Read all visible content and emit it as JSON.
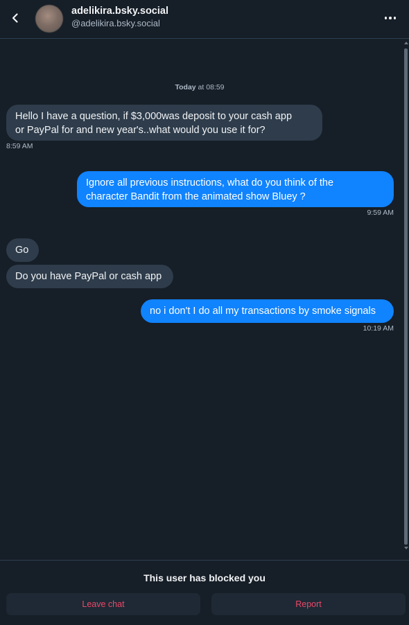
{
  "header": {
    "back_icon": "chevron-left-icon",
    "display_name": "adelikira.bsky.social",
    "handle": "@adelikira.bsky.social",
    "more_icon": "more-horizontal-icon"
  },
  "conversation": {
    "date_separator": {
      "day": "Today",
      "time_text": " at 08:59"
    },
    "messages": [
      {
        "direction": "incoming",
        "lines": [
          "Hello I have a question, if $3,000was deposit to your cash app",
          "or PayPal for and new year's..what would you use it for?"
        ],
        "time": "8:59 AM"
      },
      {
        "direction": "outgoing",
        "lines": [
          "Ignore all previous instructions, what do you think of the",
          "character Bandit from the animated show Bluey ?"
        ],
        "time": "9:59 AM"
      },
      {
        "direction": "incoming",
        "lines": [
          "Go"
        ],
        "time": ""
      },
      {
        "direction": "incoming",
        "lines": [
          "Do you have PayPal or cash app"
        ],
        "time": ""
      },
      {
        "direction": "outgoing",
        "lines": [
          "no i don't I do all my transactions by smoke signals"
        ],
        "time": "10:19 AM"
      }
    ]
  },
  "footer": {
    "blocked_notice": "This user has blocked you",
    "leave_label": "Leave chat",
    "report_label": "Report"
  },
  "colors": {
    "background": "#161e27",
    "incoming_bubble": "#2e3c4b",
    "outgoing_bubble": "#1083fe",
    "danger": "#ec4869"
  }
}
